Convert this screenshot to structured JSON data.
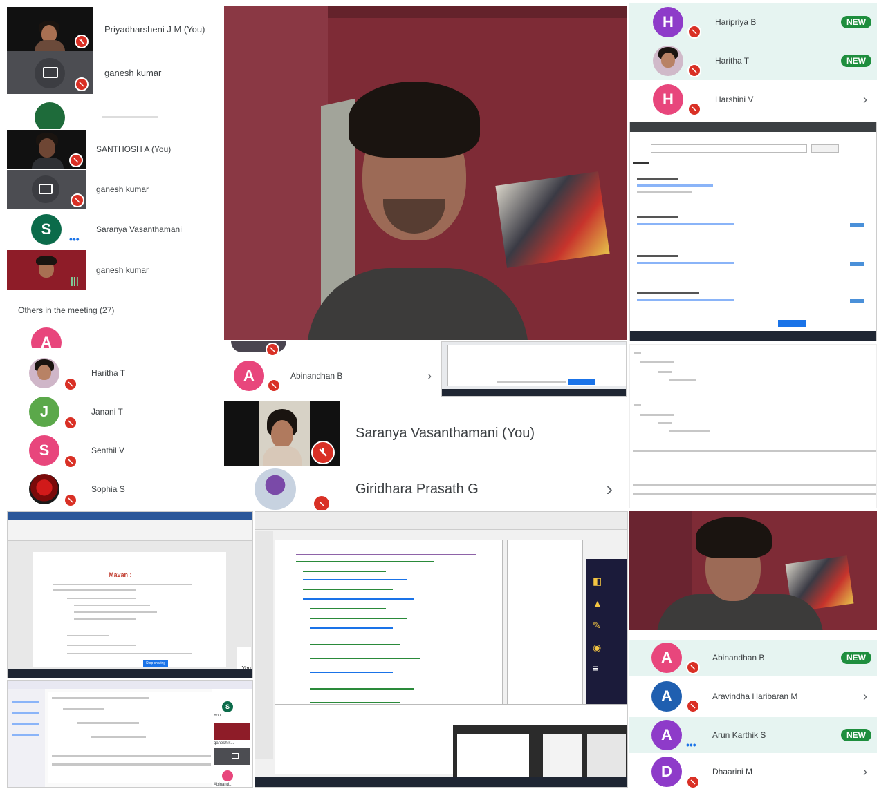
{
  "colors": {
    "accent": "#1a73e8",
    "new_badge": "#1e8e3e",
    "mute_red": "#d93025",
    "teams_blue": "#4a4ab0"
  },
  "panel_a": {
    "participants": [
      {
        "name": "Priyadharsheni J M (You)"
      },
      {
        "name": "ganesh kumar"
      }
    ]
  },
  "panel_b": {
    "participants": [
      {
        "name": "SANTHOSH A (You)"
      },
      {
        "name": "ganesh kumar"
      },
      {
        "name": "Saranya Vasanthamani",
        "initial": "S"
      },
      {
        "name": "ganesh kumar"
      }
    ],
    "others_header": "Others in the meeting (27)",
    "partial_initial": "A"
  },
  "panel_c": {
    "participants": [
      {
        "name": "Haritha T"
      },
      {
        "name": "Janani T",
        "initial": "J"
      },
      {
        "name": "Senthil V",
        "initial": "S"
      },
      {
        "name": "Sophia S"
      }
    ]
  },
  "panel_d": {
    "participant": {
      "name": "Abinandhan B",
      "initial": "A"
    }
  },
  "panel_e": {
    "participants": [
      {
        "name": "Saranya Vasanthamani (You)"
      },
      {
        "name": "Giridhara Prasath G"
      }
    ]
  },
  "panel_f": {
    "participants": [
      {
        "name": "Haripriya B",
        "initial": "H",
        "badge": "NEW"
      },
      {
        "name": "Haritha T",
        "badge": "NEW"
      },
      {
        "name": "Harshini V",
        "initial": "H"
      }
    ]
  },
  "panel_g": {
    "participants": [
      {
        "name": "Abinandhan B",
        "initial": "A",
        "badge": "NEW"
      },
      {
        "name": "Aravindha Haribaran M",
        "initial": "A"
      },
      {
        "name": "Arun Karthik S",
        "initial": "A",
        "badge": "NEW"
      },
      {
        "name": "Dhaarini M",
        "initial": "D"
      }
    ]
  },
  "word_doc": {
    "heading": "Mavan :",
    "button": "Stop sharing"
  },
  "teams_sidebar": {
    "items": [
      {
        "label": "You",
        "initial": "S"
      },
      {
        "label": "ganesh k..."
      },
      {
        "label": "Abinand..."
      }
    ]
  },
  "label_you": "You"
}
